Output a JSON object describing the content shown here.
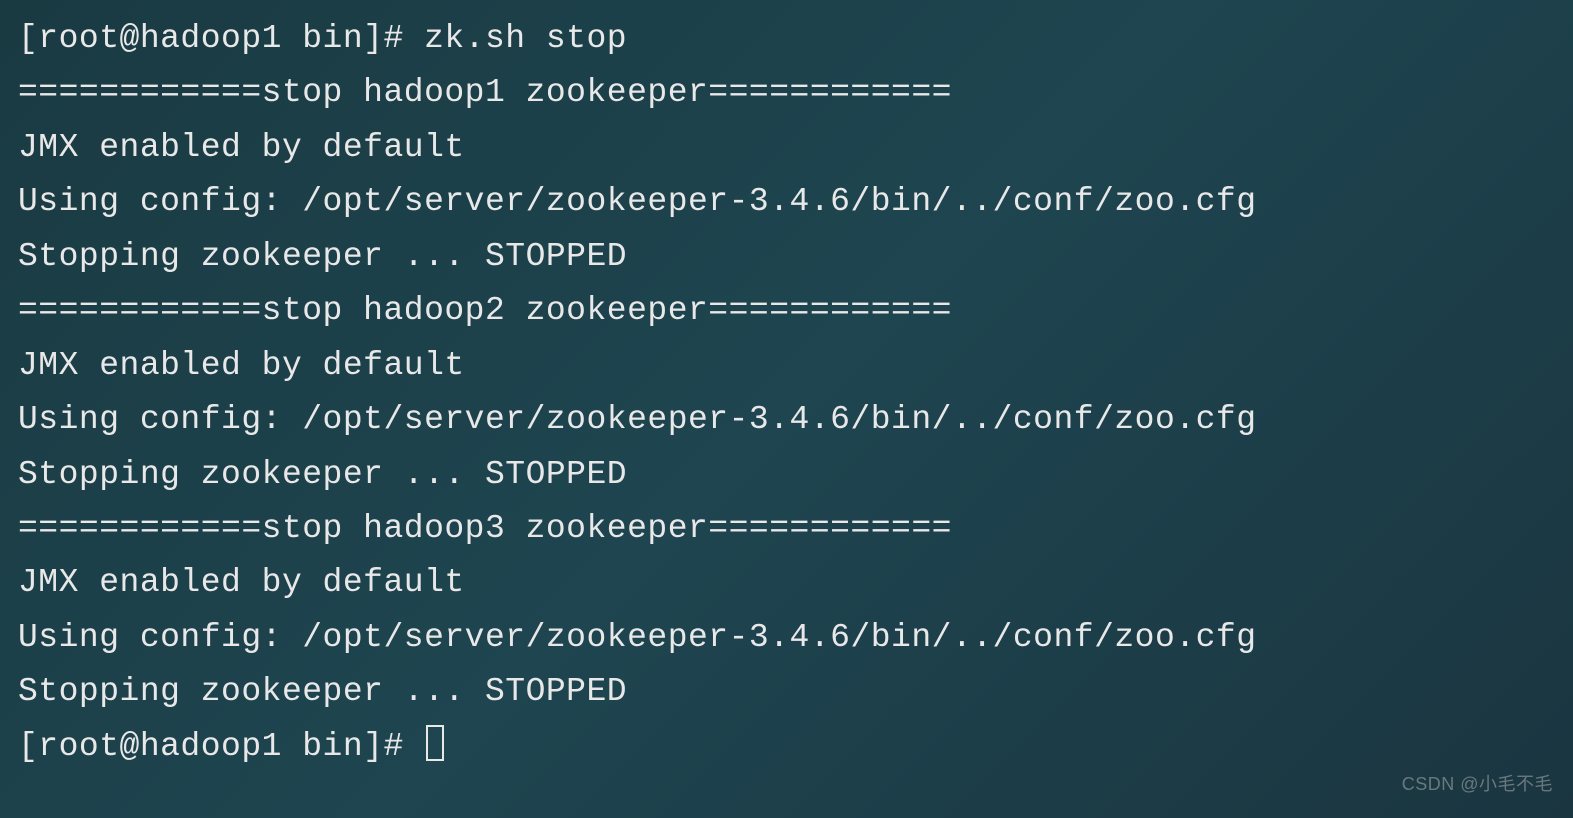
{
  "terminal": {
    "lines": [
      "[root@hadoop1 bin]# zk.sh stop",
      "============stop hadoop1 zookeeper============",
      "JMX enabled by default",
      "Using config: /opt/server/zookeeper-3.4.6/bin/../conf/zoo.cfg",
      "Stopping zookeeper ... STOPPED",
      "============stop hadoop2 zookeeper============",
      "JMX enabled by default",
      "Using config: /opt/server/zookeeper-3.4.6/bin/../conf/zoo.cfg",
      "Stopping zookeeper ... STOPPED",
      "============stop hadoop3 zookeeper============",
      "JMX enabled by default",
      "Using config: /opt/server/zookeeper-3.4.6/bin/../conf/zoo.cfg",
      "Stopping zookeeper ... STOPPED"
    ],
    "prompt": "[root@hadoop1 bin]# "
  },
  "watermark": "CSDN @小毛不毛"
}
